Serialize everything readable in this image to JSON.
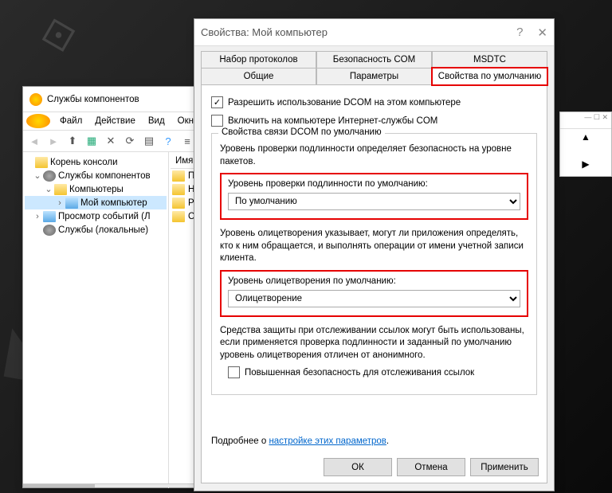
{
  "mmc": {
    "title": "Службы компонентов",
    "menu": [
      "Файл",
      "Действие",
      "Вид",
      "Окно"
    ],
    "tree": {
      "root": "Корень консоли",
      "n1": "Службы компонентов",
      "n2": "Компьютеры",
      "n3": "Мой компьютер",
      "n4": "Просмотр событий (Л",
      "n5": "Службы (локальные)"
    },
    "list_header": "Имя",
    "items": [
      "Пр",
      "На",
      "Ра",
      "С"
    ]
  },
  "dlg": {
    "title": "Свойства: Мой компьютер",
    "tabs_top": [
      "Набор протоколов",
      "Безопасность COM",
      "MSDTC"
    ],
    "tabs_bot": [
      "Общие",
      "Параметры",
      "Свойства по умолчанию"
    ],
    "chk1": "Разрешить использование DCOM на этом компьютере",
    "chk2": "Включить на компьютере Интернет-службы COM",
    "gb": "Свойства связи DCOM по умолчанию",
    "desc1": "Уровень проверки подлинности определяет безопасность на уровне пакетов.",
    "lbl1": "Уровень проверки подлинности по умолчанию:",
    "sel1": "По умолчанию",
    "desc2": "Уровень олицетворения указывает, могут ли приложения определять, кто к ним обращается, и выполнять операции от имени учетной записи клиента.",
    "lbl2": "Уровень олицетворения по умолчанию:",
    "sel2": "Олицетворение",
    "desc3": "Средства защиты при отслеживании ссылок могут быть использованы, если применяется проверка подлинности и заданный по умолчанию уровень олицетворения отличен от анонимного.",
    "chk3": "Повышенная безопасность для отслеживания ссылок",
    "more_pre": "Подробнее о ",
    "more_link": "настройке этих параметров",
    "ok": "ОК",
    "cancel": "Отмена",
    "apply": "Применить"
  }
}
